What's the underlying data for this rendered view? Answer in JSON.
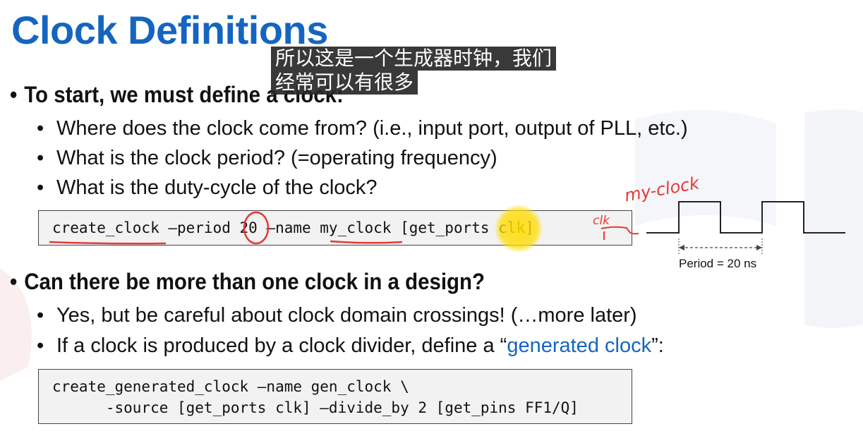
{
  "slide": {
    "title": "Clock Definitions",
    "subtitle_overlay": [
      "所以这是一个生成器时钟，我们",
      "经常可以有很多"
    ],
    "bullets": [
      {
        "text": "To start, we must define a clock:",
        "sub": [
          "Where does the clock come from? (i.e., input port, output of PLL, etc.)",
          "What is the clock period? (=operating frequency)",
          "What is the duty-cycle of the clock?"
        ]
      },
      {
        "text": "Can there be more than one clock in a design?",
        "sub": [
          "Yes, but be careful about clock domain crossings! (…more later)",
          "If a clock is produced by a clock divider, define a “",
          "generated clock",
          "”:"
        ]
      }
    ],
    "code1": "create_clock –period 20 –name my_clock [get_ports clk]",
    "code2_line1": "create_generated_clock –name gen_clock \\",
    "code2_line2": "      -source [get_ports clk] –divide_by 2 [get_pins FF1/Q]",
    "waveform": {
      "period_label": "Period = 20 ns",
      "handwritten_clock_name": "my-clock",
      "handwritten_port": "clk"
    },
    "colors": {
      "title": "#1565c0",
      "annotation_red": "#e53935",
      "code_bg": "#f2f2f2"
    }
  }
}
